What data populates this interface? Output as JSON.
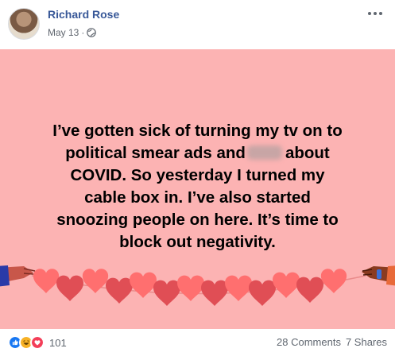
{
  "post": {
    "author": "Richard Rose",
    "date": "May 13",
    "date_separator": "·",
    "privacy_icon": "globe-icon",
    "more_icon": "more-options-icon",
    "background_color": "#fcb3b3",
    "text_lines": [
      "I’ve gotten sick of turning my tv on to",
      "political smear ads and",
      "about",
      "COVID. So yesterday I turned my",
      "cable box in. I’ve also started",
      "snoozing people on here. It’s time to",
      "block out negativity."
    ]
  },
  "reactions": {
    "icons": [
      "like-icon",
      "haha-icon",
      "love-icon"
    ],
    "count": "101"
  },
  "stats": {
    "comments": "28 Comments",
    "shares": "7 Shares"
  },
  "colors": {
    "author_link": "#385898",
    "heart_dark": "#e04e55",
    "heart_light": "#ff6f6f",
    "like": "#1877f2",
    "love": "#f33e58",
    "haha": "#f7b125"
  }
}
